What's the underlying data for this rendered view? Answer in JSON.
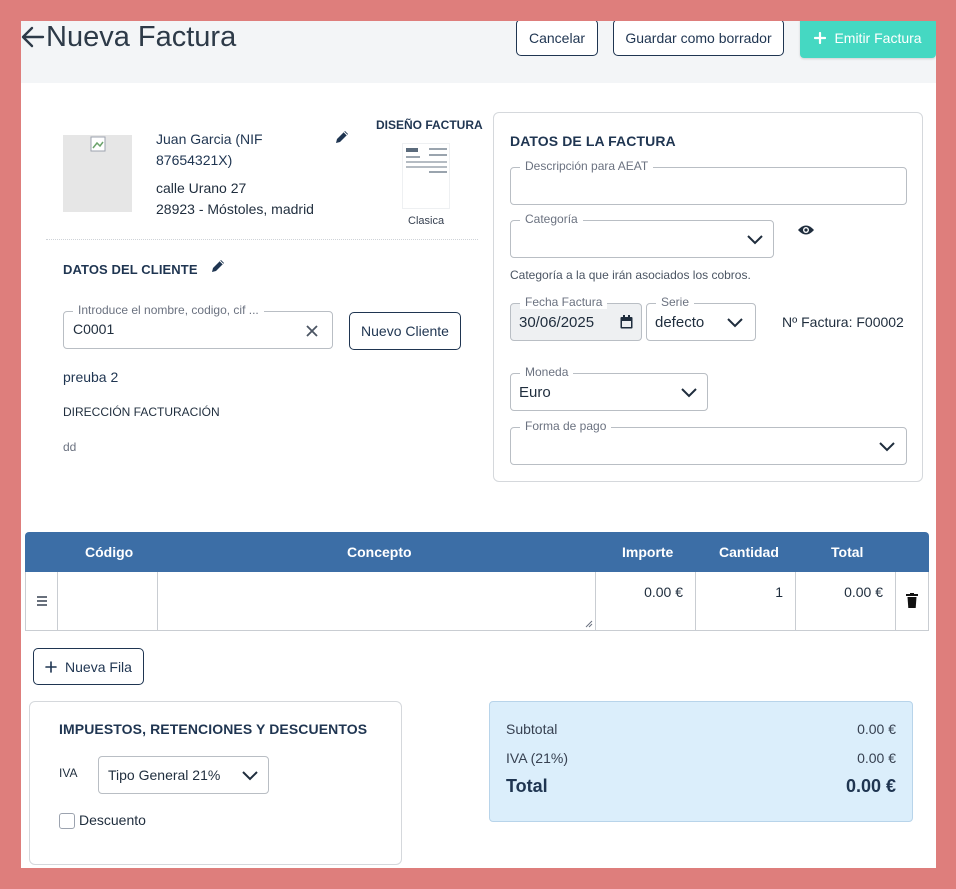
{
  "header": {
    "title": "Nueva Factura",
    "cancel_label": "Cancelar",
    "draft_label": "Guardar como borrador",
    "emit_label": "Emitir Factura"
  },
  "company": {
    "name_line1": "Juan Garcia (NIF",
    "name_line2": "87654321X)",
    "address_line1": "calle Urano 27",
    "address_line2": "28923 - Móstoles, madrid"
  },
  "design": {
    "heading": "DISEÑO FACTURA",
    "template_name": "Clasica"
  },
  "client": {
    "heading": "DATOS DEL CLIENTE",
    "search_label": "Introduce el nombre, codigo, cif ...",
    "search_value": "C0001",
    "new_client_label": "Nuevo Cliente",
    "client_name": "preuba 2",
    "billing_heading": "DIRECCIÓN FACTURACIÓN",
    "billing_value": "dd"
  },
  "invoice": {
    "heading": "DATOS DE LA FACTURA",
    "aeat_label": "Descripción para AEAT",
    "aeat_value": "",
    "category_label": "Categoría",
    "category_value": "",
    "category_help": "Categoría a la que irán asociados los cobros.",
    "date_label": "Fecha Factura",
    "date_value": "30/06/2025",
    "series_label": "Serie",
    "series_value": "defecto",
    "number_text": "Nº Factura: F00002",
    "currency_label": "Moneda",
    "currency_value": "Euro",
    "payment_label": "Forma de pago",
    "payment_value": ""
  },
  "table": {
    "columns": [
      "Código",
      "Concepto",
      "Importe",
      "Cantidad",
      "Total"
    ],
    "rows": [
      {
        "codigo": "",
        "concepto": "",
        "importe": "0.00 €",
        "cantidad": "1",
        "total": "0.00 €"
      }
    ],
    "new_row_label": "Nueva Fila"
  },
  "taxes": {
    "heading": "IMPUESTOS, RETENCIONES Y DESCUENTOS",
    "iva_label": "IVA",
    "iva_value": "Tipo General 21%",
    "discount_label": "Descuento"
  },
  "totals": {
    "subtotal_label": "Subtotal",
    "subtotal_value": "0.00 €",
    "iva_label": "IVA (21%)",
    "iva_value": "0.00 €",
    "total_label": "Total",
    "total_value": "0.00 €"
  },
  "colors": {
    "frame": "#de7e7c",
    "primary": "#45d8c2",
    "table_header": "#3c6ea6",
    "totals_bg": "#dbeefb",
    "heading_text": "#1f3551"
  },
  "icons": [
    "back-arrow-icon",
    "plus-icon",
    "edit-pencil-icon",
    "clear-x-icon",
    "chevron-down-icon",
    "eye-icon",
    "calendar-icon",
    "drag-handle-icon",
    "trash-icon",
    "checkbox-icon"
  ]
}
